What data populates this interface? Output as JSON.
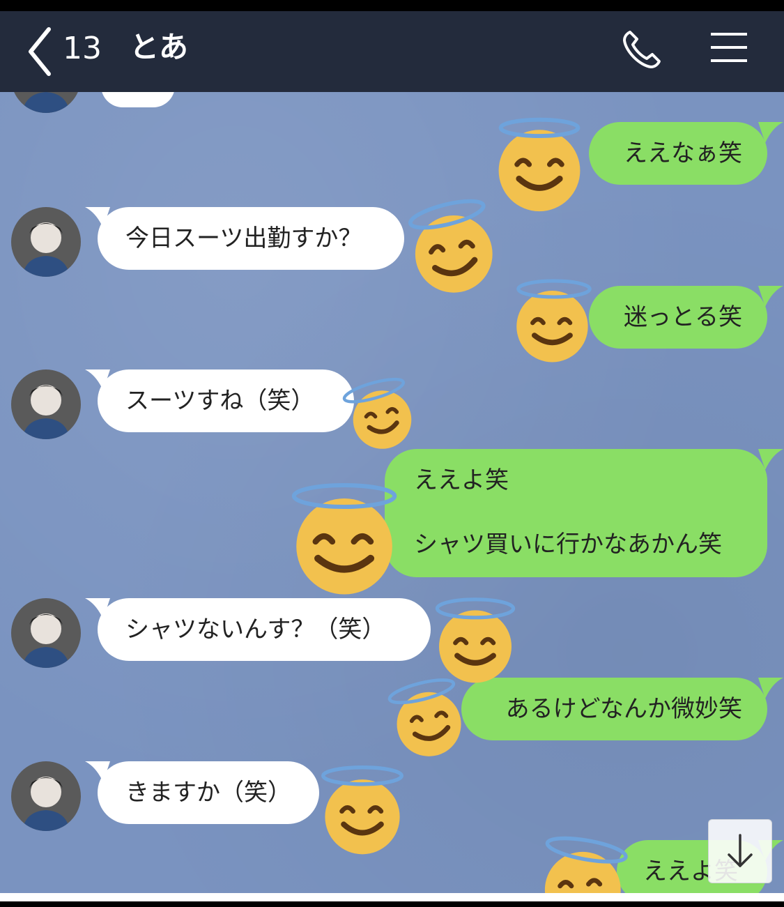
{
  "header": {
    "unread_count": "13",
    "contact_name": "とあ"
  },
  "messages": [
    {
      "side": "out",
      "text": "ええなぁ笑"
    },
    {
      "side": "in",
      "text": "今日スーツ出勤すか？"
    },
    {
      "side": "out",
      "text": "迷っとる笑"
    },
    {
      "side": "in",
      "text": "スーツすね（笑）"
    },
    {
      "side": "out",
      "line1": "ええよ笑",
      "line2": "シャツ買いに行かなあかん笑"
    },
    {
      "side": "in",
      "text": "シャツないんす？（笑）"
    },
    {
      "side": "out",
      "text": "あるけどなんか微妙笑"
    },
    {
      "side": "in",
      "text": "きますか（笑）"
    },
    {
      "side": "out",
      "text": "ええよ笑"
    }
  ],
  "icons": {
    "back": "chevron-left-icon",
    "call": "phone-icon",
    "menu": "hamburger-menu-icon",
    "scroll": "arrow-down-icon",
    "sticker": "smiling-face-with-halo-emoji"
  },
  "colors": {
    "header_bg": "#232b3c",
    "chat_bg": "#7a93c0",
    "outgoing_bubble": "#8ade65",
    "incoming_bubble": "#ffffff"
  }
}
